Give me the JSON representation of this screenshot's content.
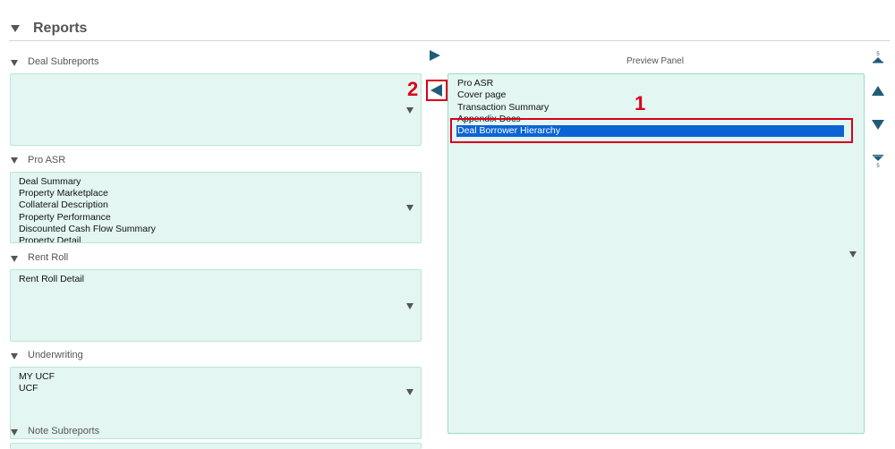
{
  "header": {
    "title": "Reports"
  },
  "sections": [
    {
      "label": "Deal Subreports",
      "items": []
    },
    {
      "label": "Pro ASR",
      "items": [
        "Deal Summary",
        "Property Marketplace",
        "Collateral Description",
        "Property Performance",
        "Discounted Cash Flow Summary",
        "Property Detail"
      ]
    },
    {
      "label": "Rent Roll",
      "items": [
        "Rent Roll Detail"
      ]
    },
    {
      "label": "Underwriting",
      "items": [
        "MY UCF",
        "UCF"
      ]
    },
    {
      "label": "Note Subreports",
      "items": []
    }
  ],
  "preview": {
    "title": "Preview Panel",
    "items": [
      "Pro ASR",
      "Cover page",
      "Transaction Summary",
      "Appendix Docs",
      "Deal Borrower Hierarchy"
    ],
    "selected_item": "Deal Borrower Hierarchy"
  },
  "annotations": {
    "callout_1": "1",
    "callout_2": "2"
  },
  "order_controls": {
    "top_glyph": "5",
    "bottom_glyph": "5"
  },
  "colors": {
    "accent": "#1f5c7a",
    "selection": "#0b63d6",
    "annotation": "#d9001b",
    "list_bg": "#e3f6f1"
  }
}
